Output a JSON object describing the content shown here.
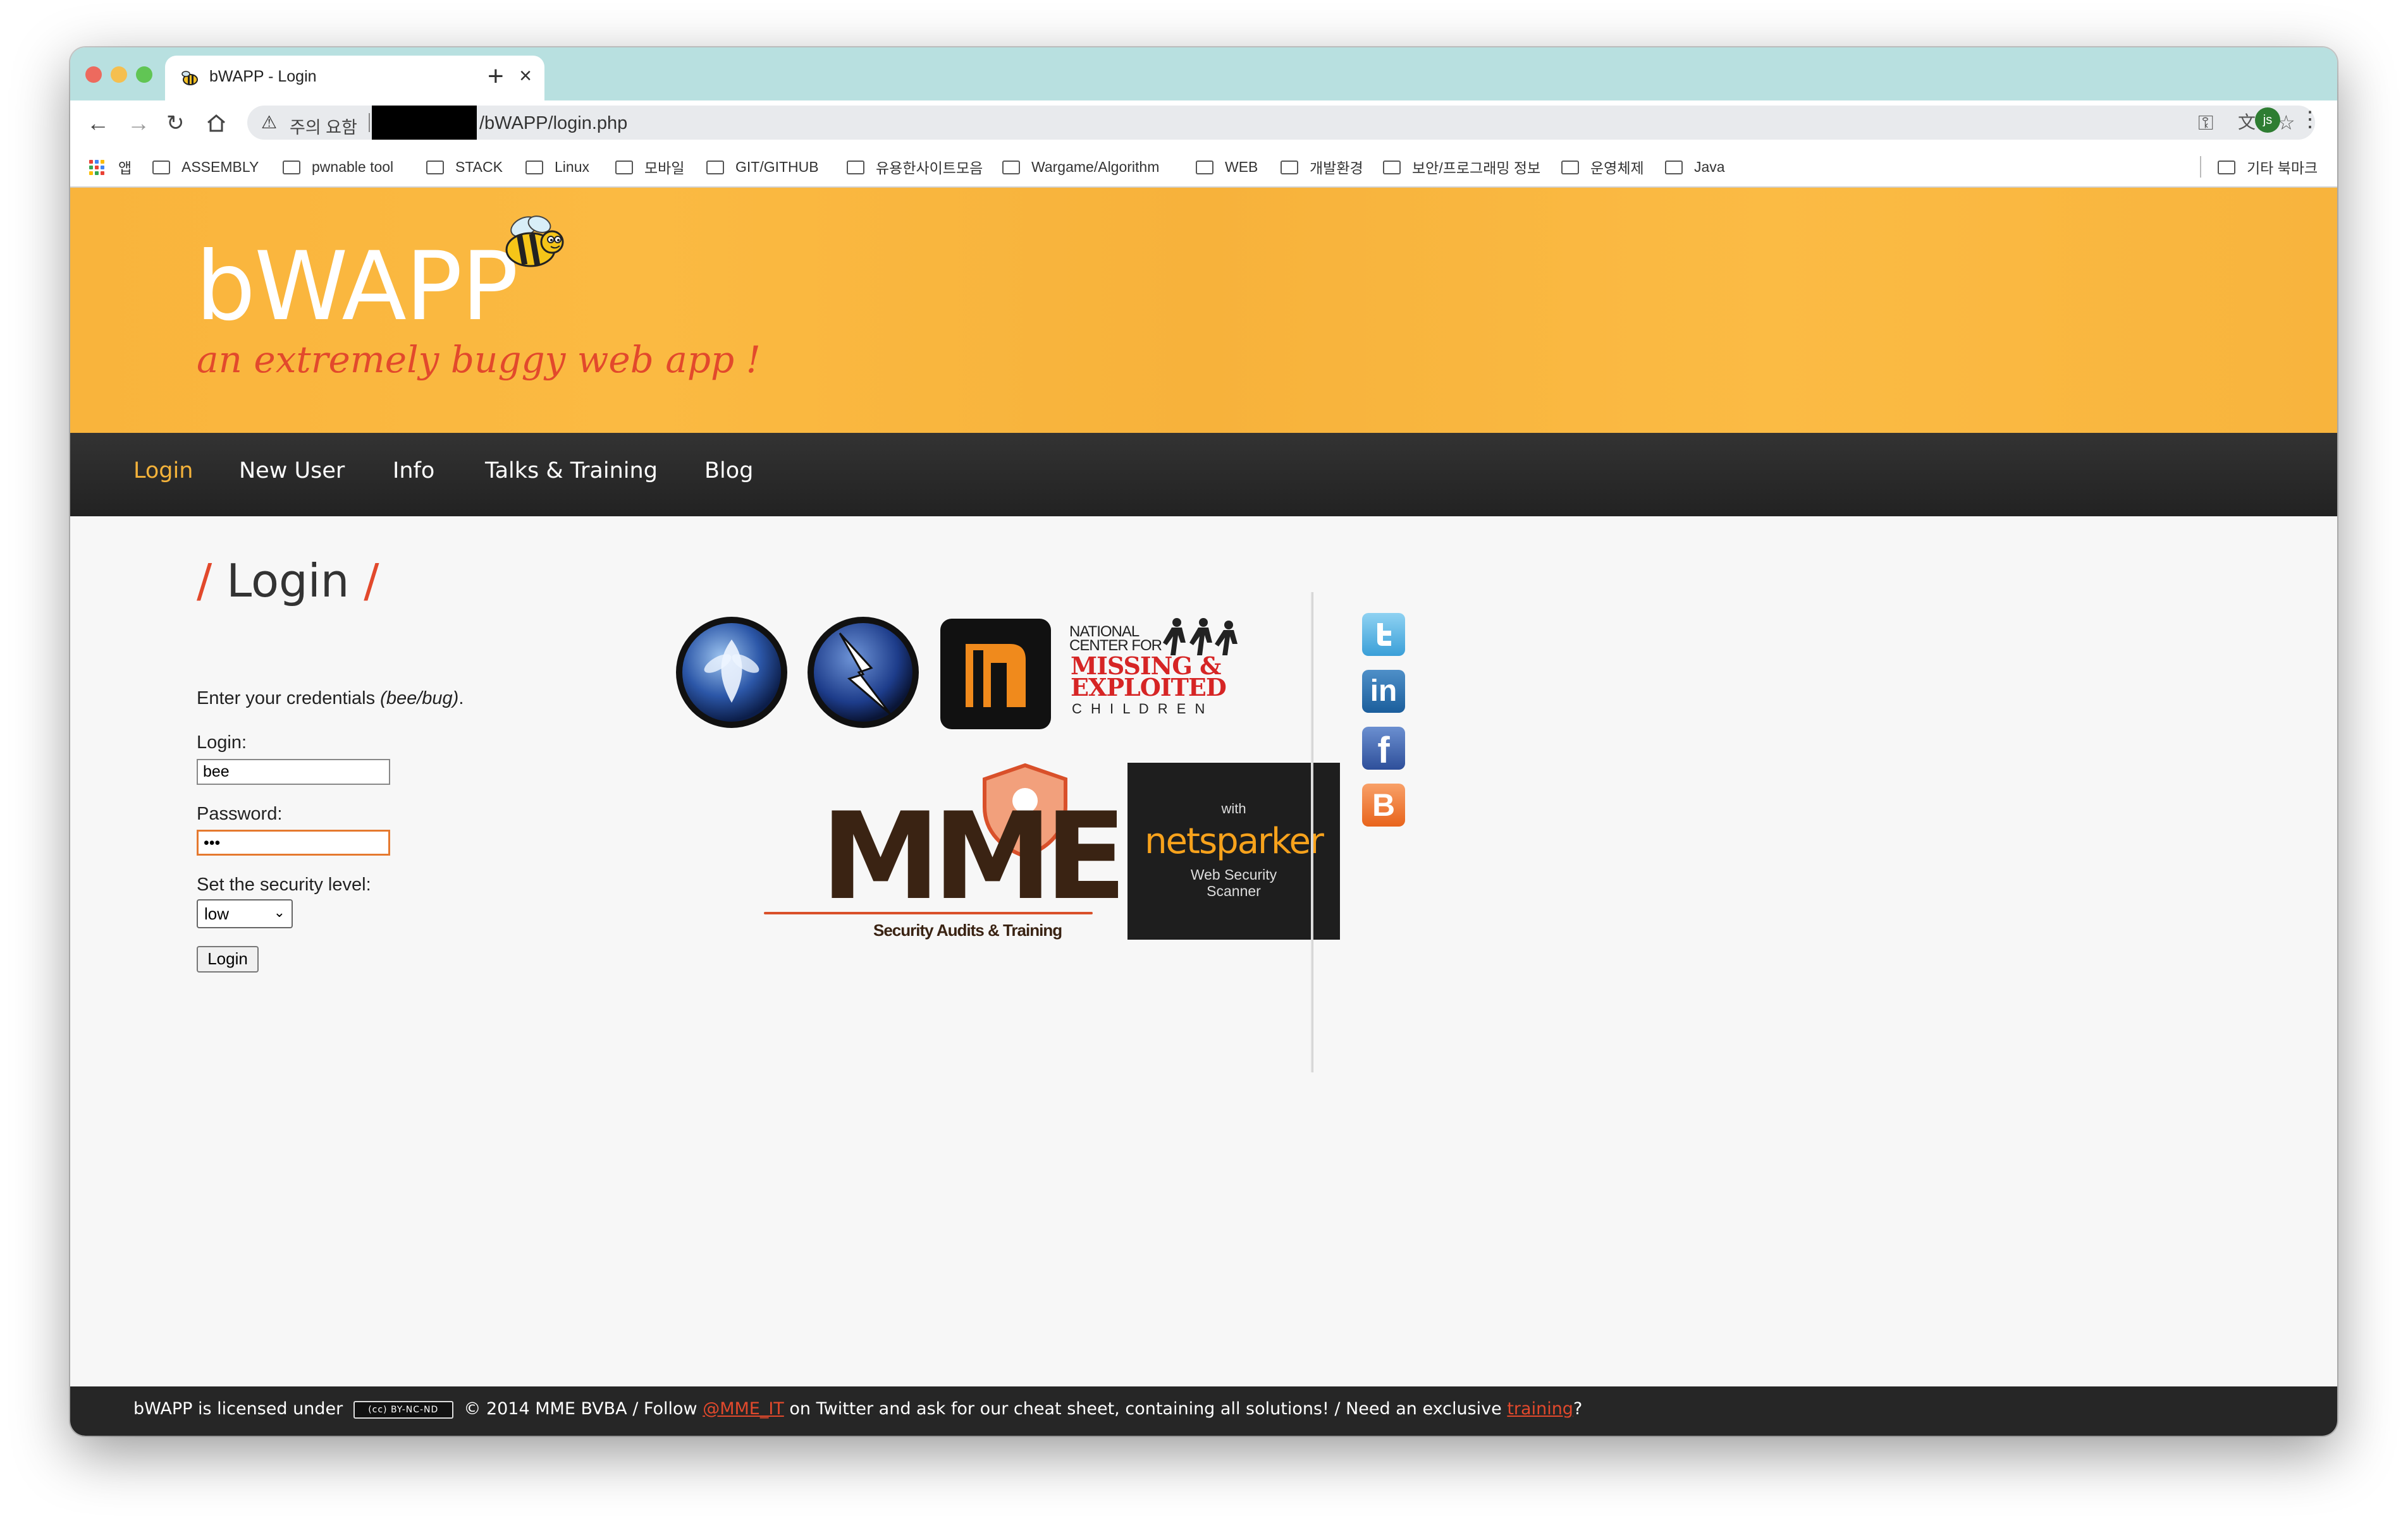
{
  "browser": {
    "tab_title": "bWAPP - Login",
    "new_tab_symbol": "+",
    "close_symbol": "×",
    "security_warning": "주의 요함",
    "url_path": "/bWAPP/login.php",
    "profile_initials": "js"
  },
  "bookmarks": {
    "apps_label": "앱",
    "items": [
      "ASSEMBLY",
      "pwnable tool",
      "STACK",
      "Linux",
      "모바일",
      "GIT/GITHUB",
      "유용한사이트모음",
      "Wargame/Algorithm",
      "WEB",
      "개발환경",
      "보안/프로그래밍 정보",
      "운영체제",
      "Java"
    ],
    "other_label": "기타 북마크"
  },
  "header": {
    "logo": "bWAPP",
    "tagline": "an extremely buggy web app !"
  },
  "nav": {
    "items": [
      "Login",
      "New User",
      "Info",
      "Talks & Training",
      "Blog"
    ],
    "active_index": 0
  },
  "login": {
    "heading": "Login",
    "instructions_prefix": "Enter your credentials ",
    "instructions_hint": "(bee/bug)",
    "instructions_suffix": ".",
    "login_label": "Login:",
    "login_value": "bee",
    "password_label": "Password:",
    "password_value": "•••",
    "security_label": "Set the security level:",
    "security_value": "low",
    "submit_label": "Login"
  },
  "sponsors": {
    "nc_top": "NATIONAL\nCENTER FOR",
    "nc_main": "MISSING &\nEXPLOITED",
    "nc_bottom": "C H I L D R E N",
    "mme_logo": "MME",
    "mme_sub": "Security Audits & Training",
    "ns_with": "with",
    "ns_name": "netsparker",
    "ns_sub": "Web Security\nScanner"
  },
  "social": [
    "twitter-icon",
    "linkedin-icon",
    "facebook-icon",
    "blogger-icon"
  ],
  "footer": {
    "part1": "bWAPP is licensed under",
    "cc_badge": "(cc) BY-NC-ND",
    "part2": "© 2014 MME BVBA / Follow",
    "twitter_link": "@MME_IT",
    "part3": "on Twitter and ask for our cheat sheet, containing all solutions! / Need an exclusive",
    "training_link": "training",
    "part4": "?"
  },
  "colors": {
    "banner": "#f9b43c",
    "accent": "#e2492c",
    "navbar": "#2a2a2a"
  }
}
